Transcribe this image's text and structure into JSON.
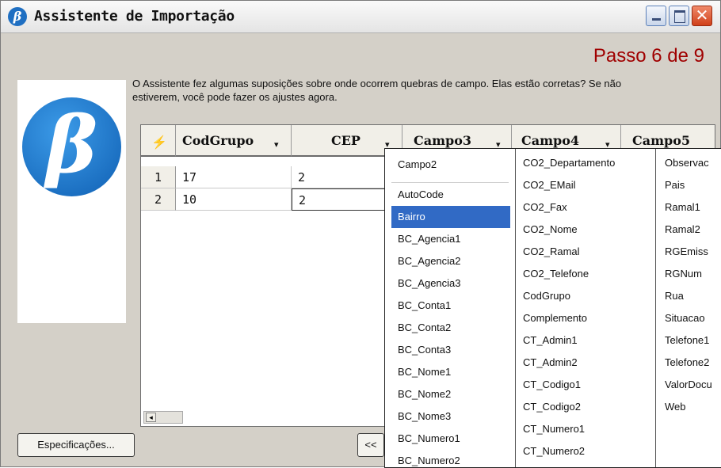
{
  "window": {
    "title": "Assistente de Importação",
    "logo_glyph": "β",
    "close_glyph": "✕"
  },
  "step": "Passo 6 de 9",
  "message": "O Assistente fez algumas suposições sobre onde ocorrem quebras de campo. Elas estão corretas? Se não estiverem, você pode fazer os ajustes agora.",
  "logo_glyph": "β",
  "grid": {
    "corner_icon": "⚡",
    "columns": [
      {
        "label": "CodGrupo",
        "arrow": "▾"
      },
      {
        "label": "CEP",
        "arrow": "▾"
      },
      {
        "label": "Campo3",
        "arrow": "▾"
      },
      {
        "label": "Campo4",
        "arrow": "▾"
      },
      {
        "label": "Campo5",
        "arrow": ""
      }
    ],
    "rows": [
      {
        "num": "1",
        "cells": [
          "17",
          "2"
        ]
      },
      {
        "num": "2",
        "cells": [
          "10",
          "2"
        ]
      }
    ],
    "scroll_left_glyph": "◂"
  },
  "buttons": {
    "specs": "Especificações...",
    "back": "<<"
  },
  "dropdown": {
    "header": "Campo2",
    "selected": "Bairro",
    "column1": [
      "AutoCode",
      "Bairro",
      "BC_Agencia1",
      "BC_Agencia2",
      "BC_Agencia3",
      "BC_Conta1",
      "BC_Conta2",
      "BC_Conta3",
      "BC_Nome1",
      "BC_Nome2",
      "BC_Nome3",
      "BC_Numero1",
      "BC_Numero2"
    ],
    "column2": [
      "CO2_Departamento",
      "CO2_EMail",
      "CO2_Fax",
      "CO2_Nome",
      "CO2_Ramal",
      "CO2_Telefone",
      "CodGrupo",
      "Complemento",
      "CT_Admin1",
      "CT_Admin2",
      "CT_Codigo1",
      "CT_Codigo2",
      "CT_Numero1",
      "CT_Numero2"
    ],
    "column3": [
      "Observac",
      "Pais",
      "Ramal1",
      "Ramal2",
      "RGEmiss",
      "RGNum",
      "Rua",
      "Situacao",
      "Telefone1",
      "Telefone2",
      "ValorDocu",
      "Web"
    ]
  }
}
